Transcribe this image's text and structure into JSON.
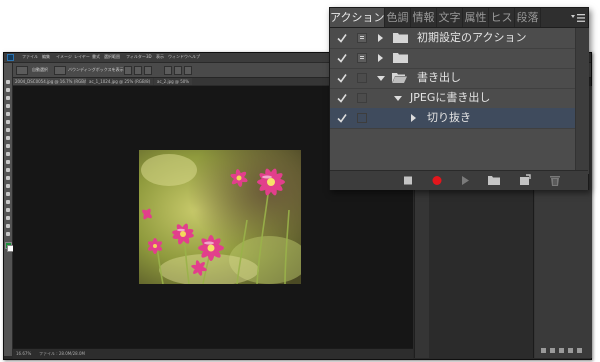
{
  "photoshop": {
    "menu": [
      "ファイル",
      "編集",
      "イメージ",
      "レイヤー",
      "書式",
      "選択範囲",
      "フィルター",
      "3D",
      "表示",
      "ウィンドウ",
      "ヘルプ"
    ],
    "options": [
      "自動選択",
      "グループ",
      "バウンディングボックスを表示"
    ],
    "document_tabs": [
      "2004_DSC0054.jpg @ 16.7% (RGB/8)",
      "ac_1_1024.jpg @ 25% (RGB/8)",
      "ac_2.jpg @ 50%"
    ],
    "status_text": [
      "16.67%",
      "ファイル : 28.0M/28.0M"
    ]
  },
  "actions_panel": {
    "tabs": [
      "アクション",
      "色調",
      "情報",
      "文字",
      "属性",
      "ヒス",
      "段落"
    ],
    "menu_icon": "panel-menu-icon",
    "rows": [
      {
        "checked": true,
        "dialog": true,
        "expanded": false,
        "type": "set",
        "label": "初期設定のアクション"
      },
      {
        "checked": true,
        "dialog": true,
        "expanded": false,
        "type": "set",
        "label": ""
      },
      {
        "checked": true,
        "dialog": false,
        "expanded": true,
        "type": "set",
        "label": "書き出し"
      },
      {
        "checked": true,
        "dialog": false,
        "expanded": true,
        "type": "action",
        "label": "JPEGに書き出し"
      },
      {
        "checked": true,
        "dialog": false,
        "expanded": false,
        "type": "step",
        "label": "切り抜き",
        "selected": true
      }
    ],
    "buttons": [
      "stop-icon",
      "record-icon",
      "play-icon",
      "new-set-icon",
      "new-action-icon",
      "trash-icon"
    ],
    "colors": {
      "record": "#e3161c",
      "selection": "#3f4b5d",
      "panel": "#4c4c4c"
    }
  }
}
